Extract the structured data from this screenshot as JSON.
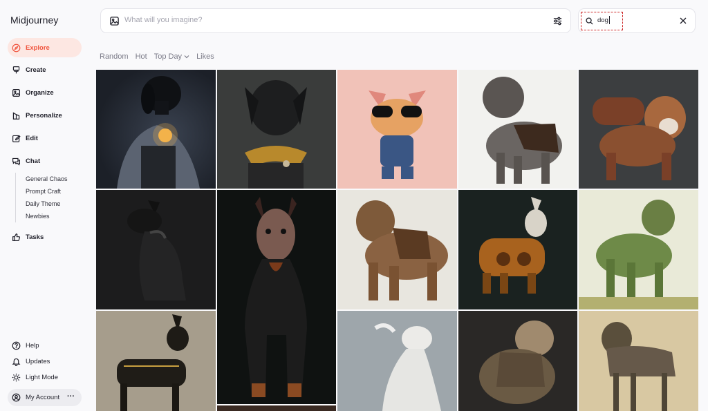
{
  "app": {
    "title": "Midjourney"
  },
  "sidebar": {
    "items": [
      {
        "label": "Explore",
        "icon": "compass-icon",
        "active": true
      },
      {
        "label": "Create",
        "icon": "brush-icon"
      },
      {
        "label": "Organize",
        "icon": "image-icon"
      },
      {
        "label": "Personalize",
        "icon": "personalize-icon"
      },
      {
        "label": "Edit",
        "icon": "edit-icon"
      },
      {
        "label": "Chat",
        "icon": "chat-icon"
      }
    ],
    "chat_rooms": [
      "General Chaos",
      "Prompt Craft",
      "Daily Theme",
      "Newbies"
    ],
    "tasks": {
      "label": "Tasks",
      "icon": "thumbs-up-icon"
    },
    "bottom": [
      {
        "label": "Help",
        "icon": "help-icon"
      },
      {
        "label": "Updates",
        "icon": "bell-icon"
      },
      {
        "label": "Light Mode",
        "icon": "sun-icon"
      }
    ],
    "account": {
      "label": "My Account",
      "menu": "···"
    }
  },
  "imagine": {
    "placeholder": "What will you imagine?"
  },
  "search": {
    "value": "dog"
  },
  "filters": {
    "random": "Random",
    "hot": "Hot",
    "top_day": "Top Day",
    "likes": "Likes"
  },
  "accent_color": "#f0553f",
  "gallery": [
    {
      "alt": "Black labrador in hooded cloak holding a glowing lantern"
    },
    {
      "alt": "Black dog portrait wearing yellow scarf and leather strap"
    },
    {
      "alt": "Cartoon french bulldog toy with sunglasses and pajamas"
    },
    {
      "alt": "Shaggy grey dog sketch wearing a leather harness"
    },
    {
      "alt": "Bulldog wearing steampunk backpack armor"
    },
    {
      "alt": "Doberman in black leather jacket sitting"
    },
    {
      "alt": "Doberman wearing a hockey mask"
    },
    {
      "alt": "Brown mastiff wearing a saddle bag"
    },
    {
      "alt": "Robotic steampunk dog with copper body"
    },
    {
      "alt": "Dog made of leaves and vines"
    },
    {
      "alt": "Black and gold robotic doberman"
    },
    {
      "alt": "White whippet leaping"
    },
    {
      "alt": "Armored pug warrior"
    },
    {
      "alt": "Gaunt zombie dog snarling"
    }
  ]
}
